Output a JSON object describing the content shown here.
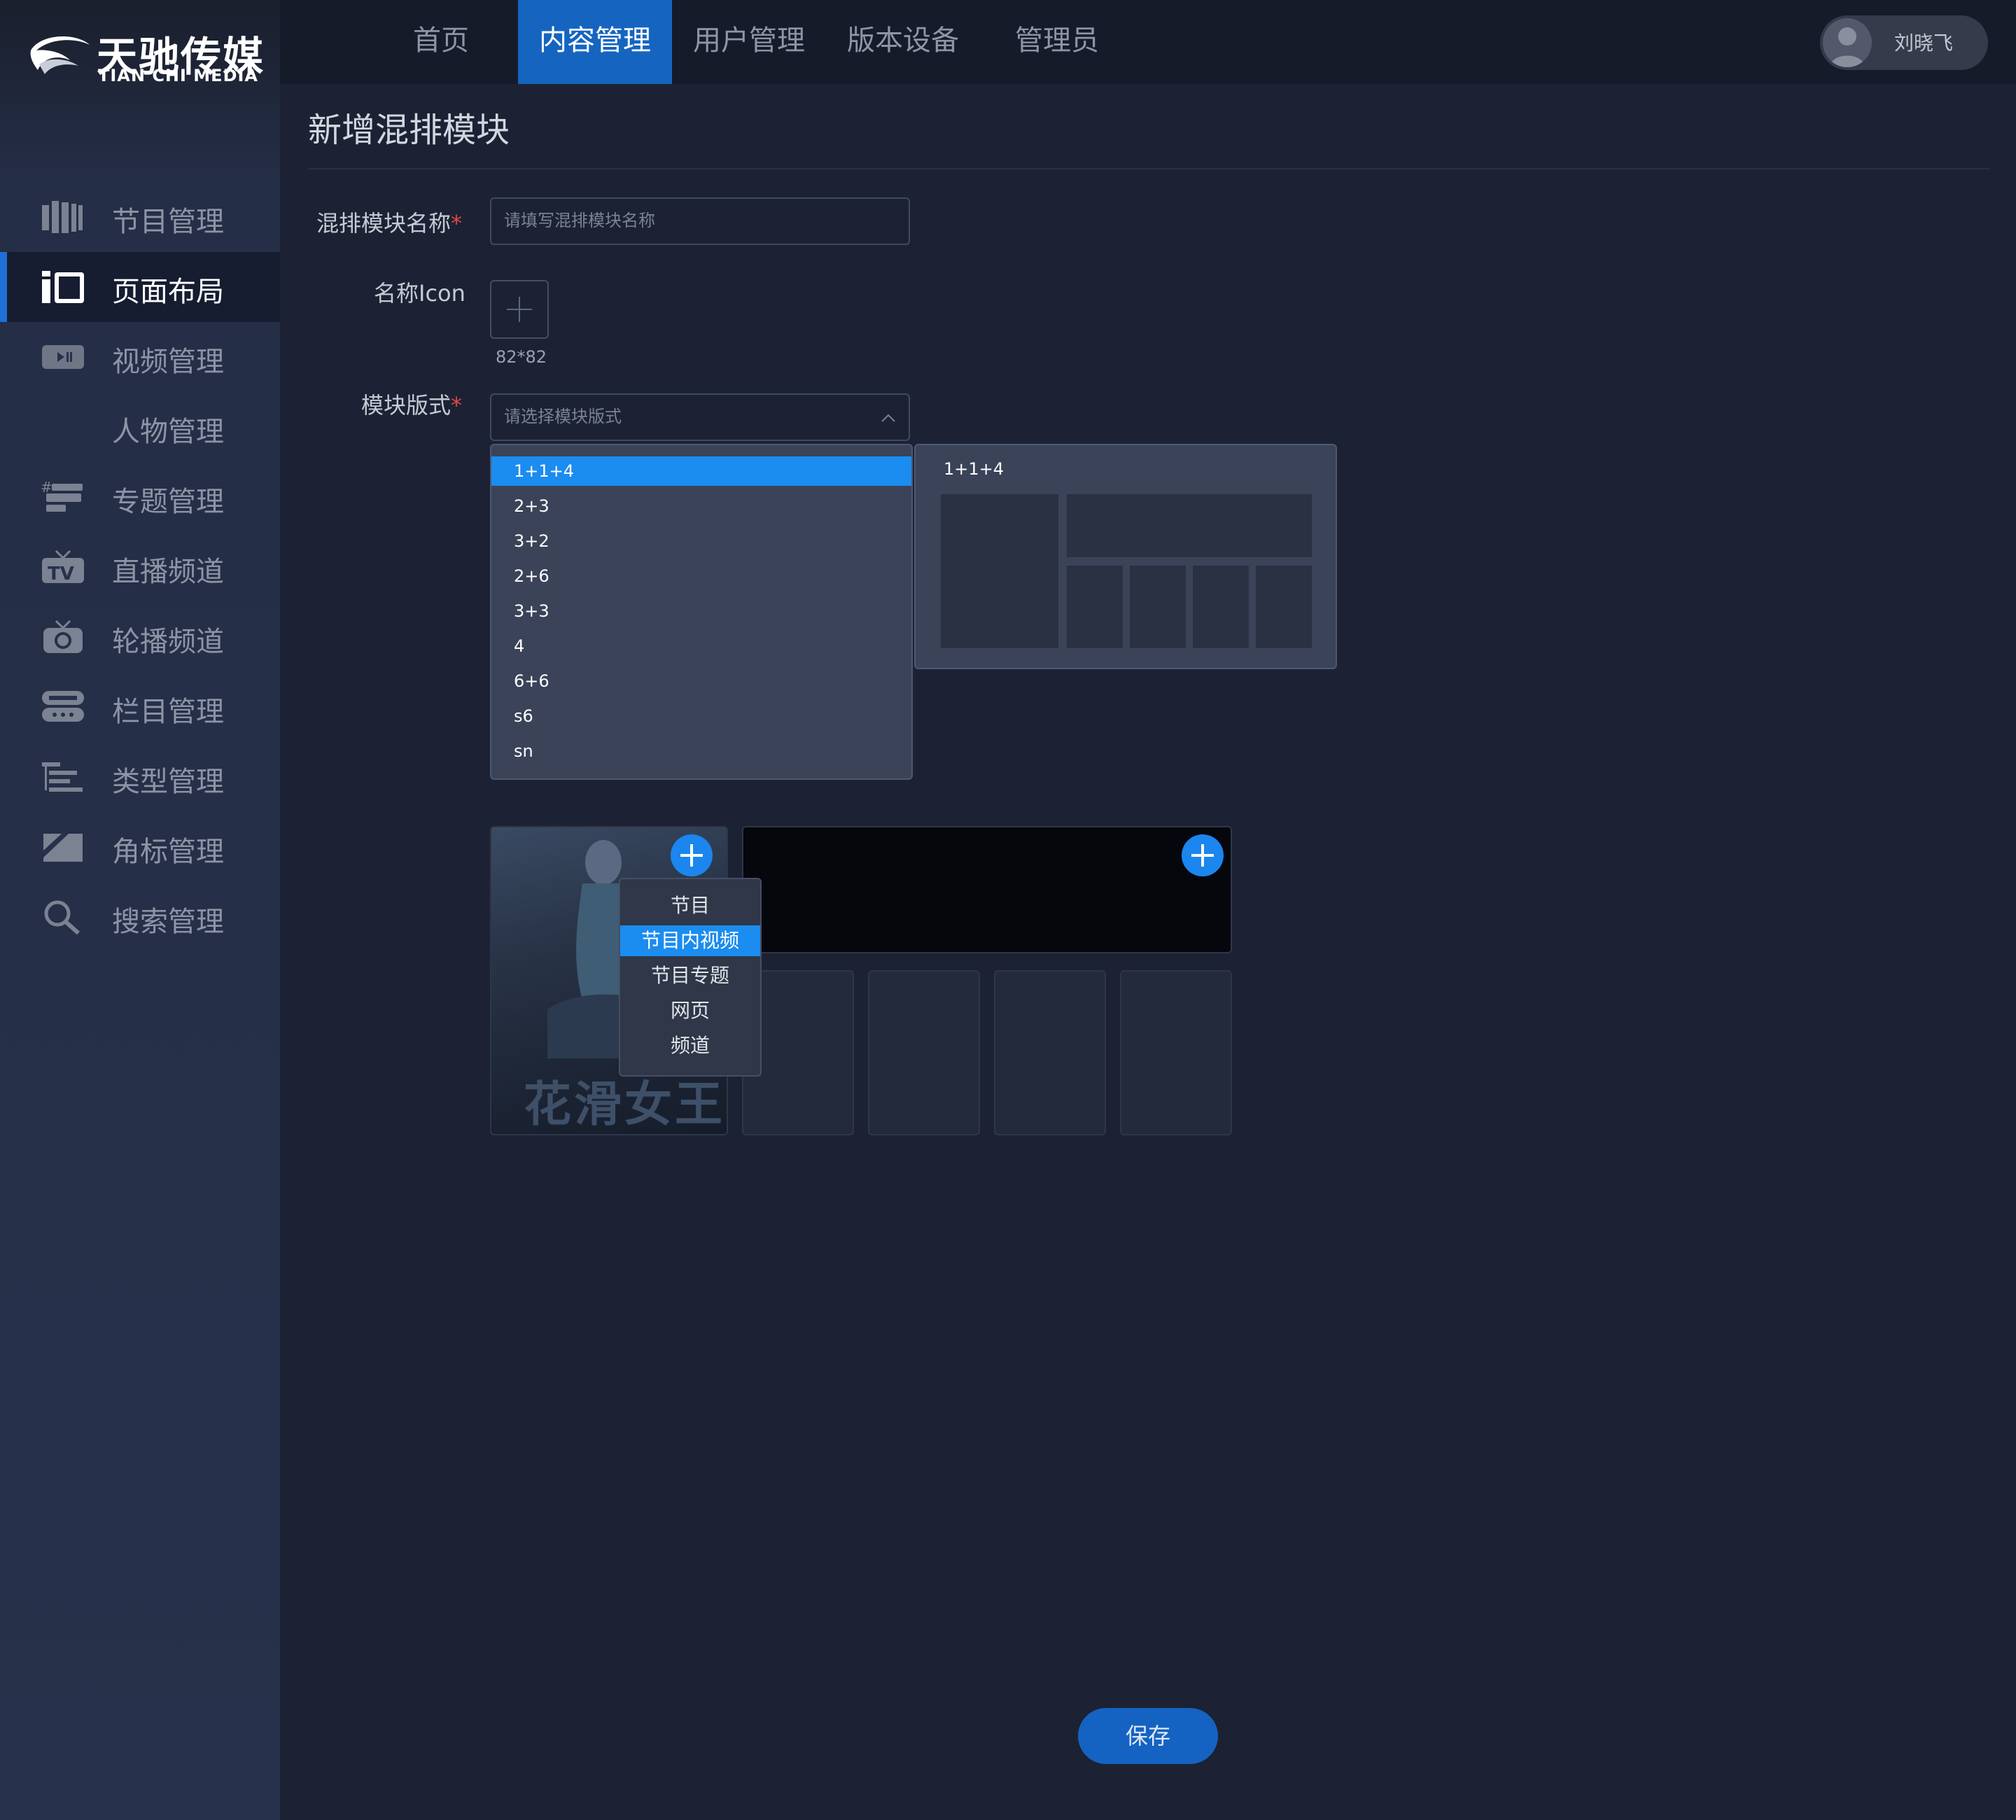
{
  "brand": {
    "name_cn": "天驰传媒",
    "name_en": "TIAN CHI MEDIA"
  },
  "sidebar": {
    "items": [
      {
        "label": "节目管理",
        "icon": "film-strip-icon"
      },
      {
        "label": "页面布局",
        "icon": "layout-icon",
        "active": true
      },
      {
        "label": "视频管理",
        "icon": "video-play-icon"
      },
      {
        "label": "人物管理",
        "icon": ""
      },
      {
        "label": "专题管理",
        "icon": "topic-stack-icon"
      },
      {
        "label": "直播频道",
        "icon": "tv-icon"
      },
      {
        "label": "轮播频道",
        "icon": "carousel-refresh-icon"
      },
      {
        "label": "栏目管理",
        "icon": "column-list-icon"
      },
      {
        "label": "类型管理",
        "icon": "type-tree-icon"
      },
      {
        "label": "角标管理",
        "icon": "corner-badge-icon"
      },
      {
        "label": "搜索管理",
        "icon": "search-icon"
      }
    ]
  },
  "topnav": {
    "tabs": [
      {
        "label": "首页"
      },
      {
        "label": "内容管理",
        "active": true
      },
      {
        "label": "用户管理"
      },
      {
        "label": "版本设备"
      },
      {
        "label": "管理员"
      }
    ]
  },
  "user": {
    "name": "刘晓飞"
  },
  "page": {
    "title": "新增混排模块"
  },
  "form": {
    "name": {
      "label": "混排模块名称",
      "required_mark": "*",
      "placeholder": "请填写混排模块名称"
    },
    "icon": {
      "label": "名称Icon",
      "size_hint": "82*82"
    },
    "layout": {
      "label": "模块版式",
      "required_mark": "*",
      "placeholder": "请选择模块版式",
      "options": [
        "1+1+4",
        "2+3",
        "3+2",
        "2+6",
        "3+3",
        "4",
        "6+6",
        "s6",
        "sn"
      ],
      "selected": "1+1+4",
      "preview_label": "1+1+4"
    }
  },
  "slots": {
    "poster_title": "花滑女王",
    "menu": {
      "options": [
        "节目",
        "节目内视频",
        "节目专题",
        "网页",
        "频道"
      ],
      "selected": "节目内视频"
    }
  },
  "actions": {
    "save": "保存"
  },
  "colors": {
    "accent": "#1565c0",
    "selection": "#1b8cf0",
    "required": "#e2444a"
  }
}
